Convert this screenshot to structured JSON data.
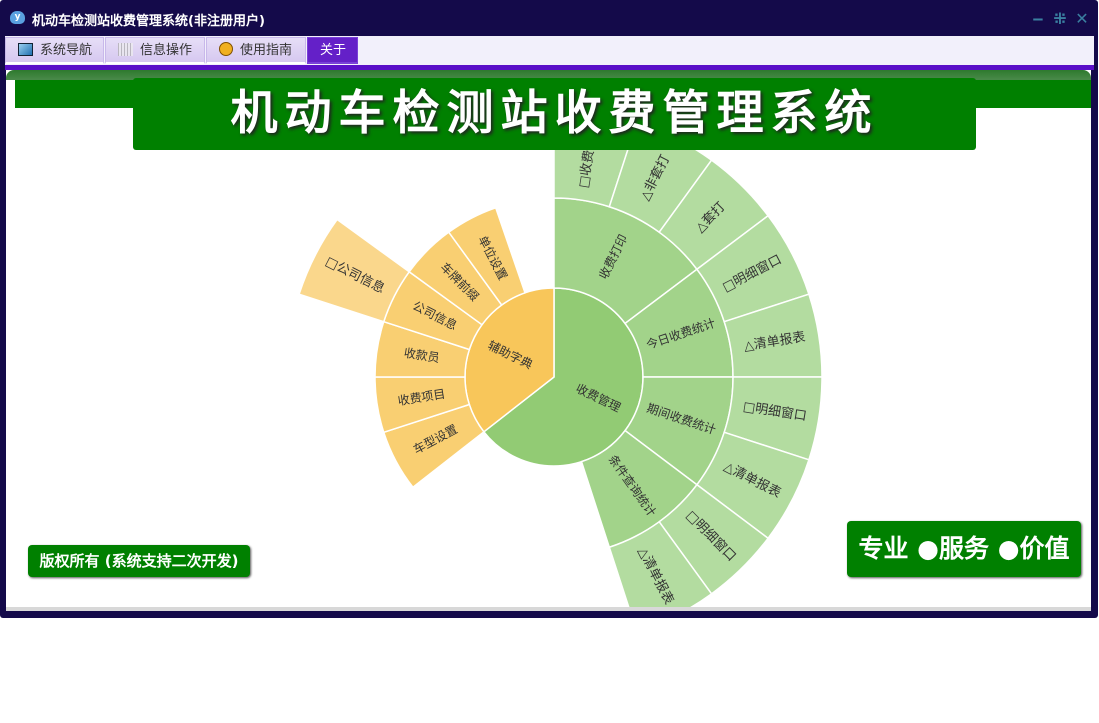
{
  "window": {
    "title": "机动车检测站收费管理系统(非注册用户)",
    "icon": "app-logo-icon",
    "controls": [
      "minimize",
      "restore",
      "close"
    ]
  },
  "tabs": [
    {
      "label": "系统导航",
      "icon": "monitor-icon"
    },
    {
      "label": "信息操作",
      "icon": "grid-icon"
    },
    {
      "label": "使用指南",
      "icon": "help-icon"
    },
    {
      "label": "关于",
      "active": true
    }
  ],
  "banner": {
    "title": "机动车检测站收费管理系统"
  },
  "footer": {
    "copyright": "版权所有 (系统支持二次开发)",
    "slogan": "专业 ●服务 ●价值"
  },
  "colors": {
    "titlebar": "#140a4a",
    "accent": "#5a0fc8",
    "banner": "#008000",
    "green": [
      "#92cb74",
      "#a2d38a",
      "#b3dca0"
    ],
    "orange": [
      "#f8c65a",
      "#f9cf72",
      "#fad78c"
    ]
  },
  "chart_data": {
    "type": "sunburst",
    "unit": "degrees",
    "nodes": [
      {
        "name": "收费管理",
        "value": 232,
        "color": "green",
        "children": [
          {
            "name": "收费打印",
            "value": 53,
            "children": [
              {
                "name": "□收费打印",
                "value": 18
              },
              {
                "name": "△非套打",
                "value": 18
              },
              {
                "name": "△套打",
                "value": 17
              }
            ]
          },
          {
            "name": "今日收费统计",
            "value": 37,
            "children": [
              {
                "name": "□明细窗口",
                "value": 19
              },
              {
                "name": "△清单报表",
                "value": 18
              }
            ]
          },
          {
            "name": "期间收费统计",
            "value": 37,
            "children": [
              {
                "name": "□明细窗口",
                "value": 18
              },
              {
                "name": "△清单报表",
                "value": 19
              }
            ]
          },
          {
            "name": "条件查询统计",
            "value": 35,
            "children": [
              {
                "name": "□明细窗口",
                "value": 17
              },
              {
                "name": "△清单报表",
                "value": 18
              }
            ]
          }
        ]
      },
      {
        "name": "辅助字典",
        "value": 128,
        "color": "orange",
        "children": [
          {
            "name": "车型设置",
            "value": 20
          },
          {
            "name": "收费项目",
            "value": 18
          },
          {
            "name": "收款员",
            "value": 18
          },
          {
            "name": "公司信息",
            "value": 18,
            "children": [
              {
                "name": "□公司信息",
                "value": 18
              }
            ]
          },
          {
            "name": "车牌前缀",
            "value": 18
          },
          {
            "name": "单位设置",
            "value": 17
          }
        ]
      }
    ]
  }
}
